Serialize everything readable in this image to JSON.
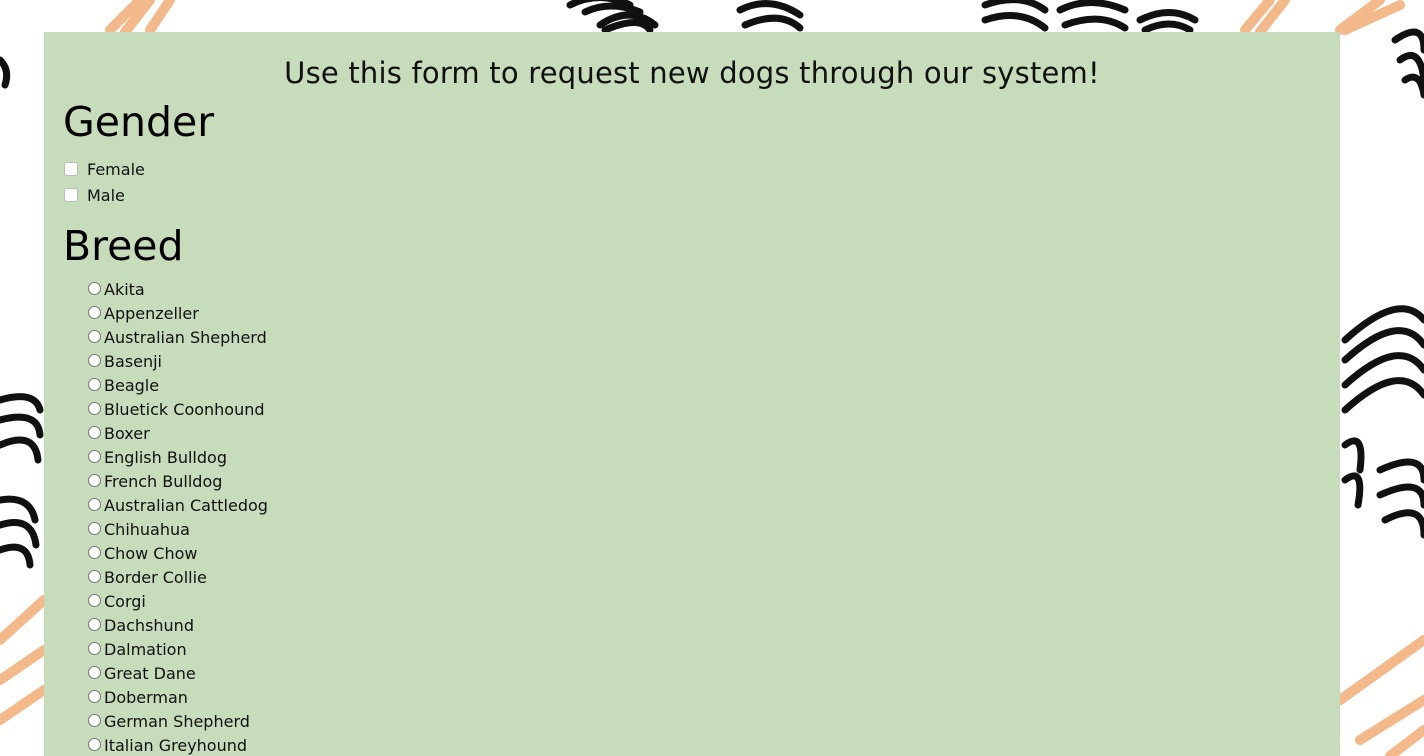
{
  "intro_text": "Use this form to request new dogs through our system!",
  "gender": {
    "title": "Gender",
    "options": [
      "Female",
      "Male"
    ]
  },
  "breed": {
    "title": "Breed",
    "options": [
      "Akita",
      "Appenzeller",
      "Australian Shepherd",
      "Basenji",
      "Beagle",
      "Bluetick Coonhound",
      "Boxer",
      "English Bulldog",
      "French Bulldog",
      "Australian Cattledog",
      "Chihuahua",
      "Chow Chow",
      "Border Collie",
      "Corgi",
      "Dachshund",
      "Dalmation",
      "Great Dane",
      "Doberman",
      "German Shepherd",
      "Italian Greyhound"
    ]
  },
  "colors": {
    "panel": "#c7dcbb",
    "scribble_black": "#111111",
    "scribble_orange": "#f4b98a"
  }
}
